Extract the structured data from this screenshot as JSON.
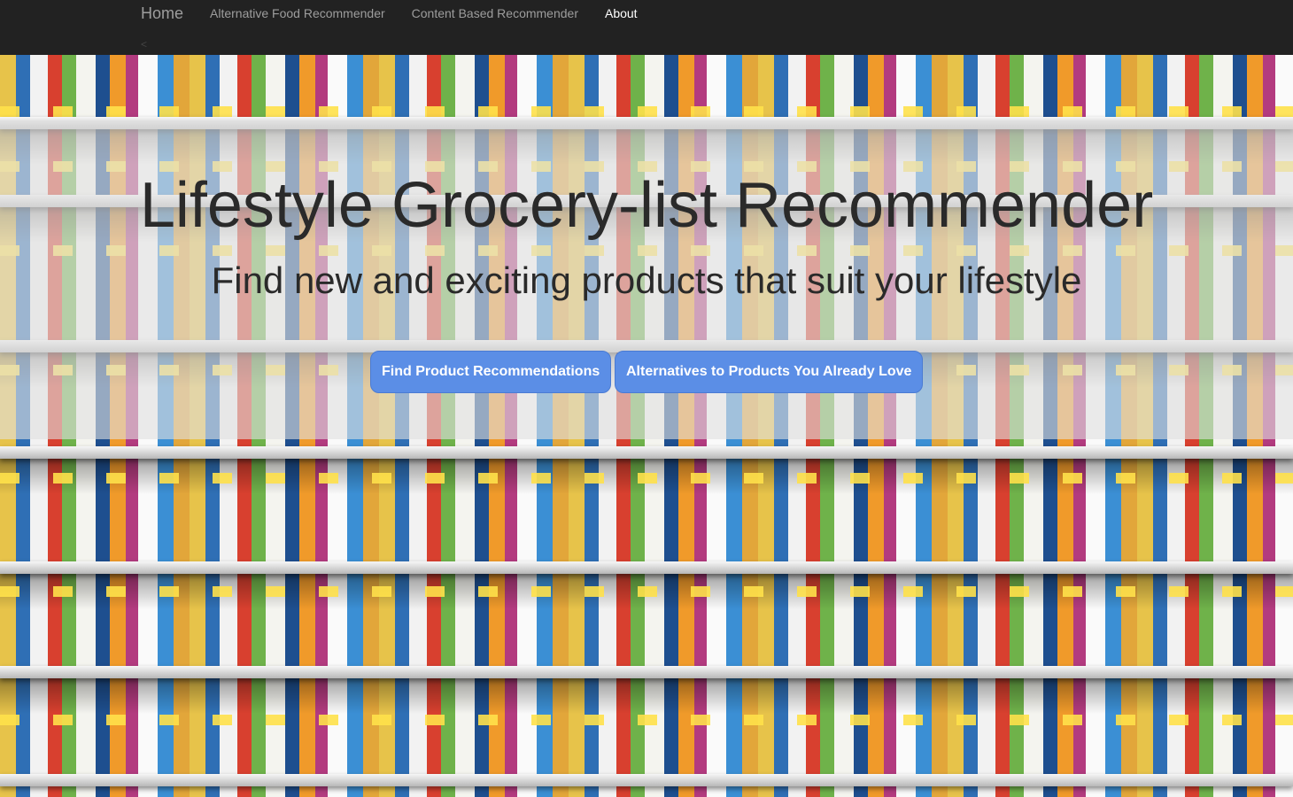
{
  "navbar": {
    "brand": "Home",
    "links": [
      {
        "label": "Alternative Food Recommender",
        "active": false
      },
      {
        "label": "Content Based Recommender",
        "active": false
      },
      {
        "label": "About",
        "active": true
      }
    ],
    "caret": "<",
    "background": "#222222"
  },
  "hero": {
    "title": "Lifestyle Grocery-list Recommender",
    "subtitle": "Find new and exciting products that suit your lifestyle",
    "buttons": {
      "find": "Find Product Recommendations",
      "alternatives": "Alternatives to Products You Already Love"
    },
    "button_color": "#5b8ee6",
    "background_image": "grocery-shelves-photo"
  }
}
